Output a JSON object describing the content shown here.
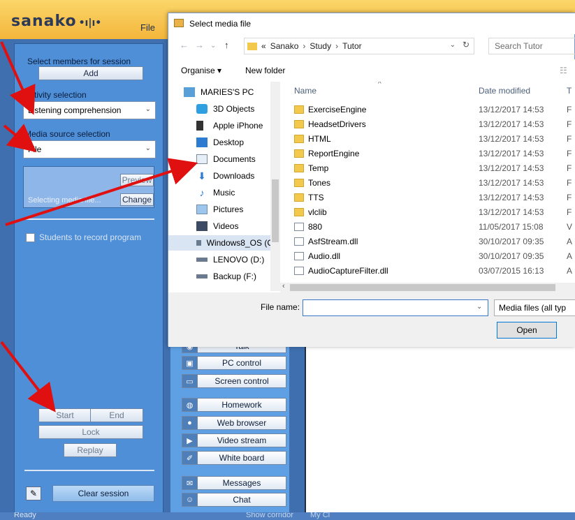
{
  "app": {
    "logo": "sanako",
    "file_menu": "File",
    "left_panel": {
      "select_members_label": "Select members for session",
      "add_button": "Add",
      "activity_label": "Activity selection",
      "activity_value": "Listening comprehension",
      "media_label": "Media source selection",
      "media_value": "File",
      "preview_button": "Preview",
      "change_button": "Change",
      "selecting_text": "Selecting media file...",
      "record_checkbox": "Students to record program",
      "start_button": "Start",
      "end_button": "End",
      "lock_button": "Lock",
      "replay_button": "Replay",
      "clear_session_button": "Clear session"
    },
    "tools": [
      {
        "label": "Talk",
        "icon": "talk-icon"
      },
      {
        "label": "PC control",
        "icon": "pc-control-icon"
      },
      {
        "label": "Screen control",
        "icon": "screen-control-icon"
      },
      {
        "label": "Homework",
        "icon": "homework-icon"
      },
      {
        "label": "Web browser",
        "icon": "web-browser-icon"
      },
      {
        "label": "Video stream",
        "icon": "video-stream-icon"
      },
      {
        "label": "White board",
        "icon": "white-board-icon"
      },
      {
        "label": "Messages",
        "icon": "messages-icon"
      },
      {
        "label": "Chat",
        "icon": "chat-icon"
      }
    ],
    "status": {
      "ready": "Ready",
      "show_corridor": "Show corridor",
      "my_class": "My Cl"
    }
  },
  "dialog": {
    "title": "Select media file",
    "breadcrumb": [
      "«",
      "Sanako",
      "Study",
      "Tutor"
    ],
    "search_placeholder": "Search Tutor",
    "organise": "Organise ▾",
    "new_folder": "New folder",
    "nav_items": [
      {
        "label": "MARIES'S PC",
        "icon": "pc-icon"
      },
      {
        "label": "3D Objects",
        "icon": "3d-objects-icon"
      },
      {
        "label": "Apple iPhone",
        "icon": "phone-icon"
      },
      {
        "label": "Desktop",
        "icon": "desktop-icon"
      },
      {
        "label": "Documents",
        "icon": "documents-icon"
      },
      {
        "label": "Downloads",
        "icon": "downloads-icon"
      },
      {
        "label": "Music",
        "icon": "music-icon"
      },
      {
        "label": "Pictures",
        "icon": "pictures-icon"
      },
      {
        "label": "Videos",
        "icon": "videos-icon"
      },
      {
        "label": "Windows8_OS (C",
        "icon": "drive-icon"
      },
      {
        "label": "LENOVO (D:)",
        "icon": "drive-icon"
      },
      {
        "label": "Backup (F:)",
        "icon": "drive-icon"
      }
    ],
    "columns": {
      "name": "Name",
      "date": "Date modified",
      "type": "T"
    },
    "files": [
      {
        "name": "ExerciseEngine",
        "date": "13/12/2017 14:53",
        "type": "F",
        "kind": "folder"
      },
      {
        "name": "HeadsetDrivers",
        "date": "13/12/2017 14:53",
        "type": "F",
        "kind": "folder"
      },
      {
        "name": "HTML",
        "date": "13/12/2017 14:53",
        "type": "F",
        "kind": "folder"
      },
      {
        "name": "ReportEngine",
        "date": "13/12/2017 14:53",
        "type": "F",
        "kind": "folder"
      },
      {
        "name": "Temp",
        "date": "13/12/2017 14:53",
        "type": "F",
        "kind": "folder"
      },
      {
        "name": "Tones",
        "date": "13/12/2017 14:53",
        "type": "F",
        "kind": "folder"
      },
      {
        "name": "TTS",
        "date": "13/12/2017 14:53",
        "type": "F",
        "kind": "folder"
      },
      {
        "name": "vlclib",
        "date": "13/12/2017 14:53",
        "type": "F",
        "kind": "folder"
      },
      {
        "name": "880",
        "date": "11/05/2017 15:08",
        "type": "V",
        "kind": "file"
      },
      {
        "name": "AsfStream.dll",
        "date": "30/10/2017 09:35",
        "type": "A",
        "kind": "file"
      },
      {
        "name": "Audio.dll",
        "date": "30/10/2017 09:35",
        "type": "A",
        "kind": "file"
      },
      {
        "name": "AudioCaptureFilter.dll",
        "date": "03/07/2015 16:13",
        "type": "A",
        "kind": "file"
      }
    ],
    "file_name_label": "File name:",
    "file_name_value": "",
    "file_type": "Media files (all typ",
    "open_button": "Open"
  },
  "colors": {
    "header": "#f3b63b",
    "panel": "#4f8fd8",
    "arrow": "#e01010"
  }
}
